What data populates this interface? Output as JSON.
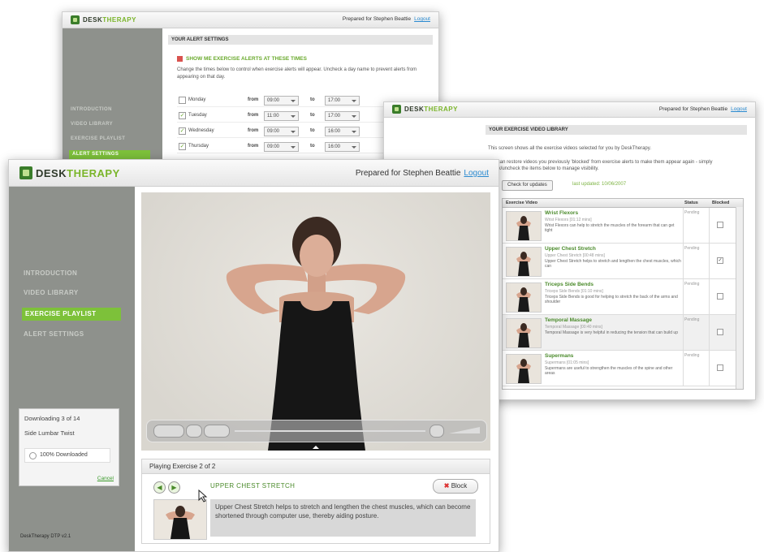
{
  "brand": {
    "part1": "DESK",
    "part2": "THERAPY"
  },
  "colors": {
    "accent_green": "#7dc13a",
    "sidebar_grey": "#8e918c",
    "link_blue": "#2a8ad0"
  },
  "user": {
    "prepared_for": "Prepared for Stephen Beattie",
    "logout": "Logout"
  },
  "alerts_window": {
    "section_title": "YOUR ALERT SETTINGS",
    "heading": "SHOW ME EXERCISE ALERTS AT THESE TIMES",
    "instructions": "Change the times below to control when exercise alerts will appear. Uncheck a day name to prevent alerts from appearing on that day.",
    "nav": [
      "INTRODUCTION",
      "VIDEO LIBRARY",
      "EXERCISE PLAYLIST",
      "ALERT SETTINGS"
    ],
    "from_label": "from",
    "to_label": "to",
    "days": [
      {
        "day": "Monday",
        "checked": false,
        "from": "09:00",
        "to": "17:00"
      },
      {
        "day": "Tuesday",
        "checked": true,
        "from": "11:00",
        "to": "17:00"
      },
      {
        "day": "Wednesday",
        "checked": true,
        "from": "09:00",
        "to": "16:00"
      },
      {
        "day": "Thursday",
        "checked": true,
        "from": "09:00",
        "to": "16:00"
      }
    ]
  },
  "library_window": {
    "section_title": "YOUR EXERCISE VIDEO LIBRARY",
    "intro": "This screen shows all the exercise videos selected for you by DeskTherapy.",
    "intro2": "You can restore videos you previously 'blocked' from exercise alerts to make them appear again - simply check/uncheck the items below to manage visibility.",
    "check_button": "Check for updates",
    "last_updated": "last updated: 10/06/2007",
    "columns": [
      "Exercise Video",
      "Status",
      "Blocked"
    ],
    "rows": [
      {
        "title": "Wrist Flexors",
        "meta": "Wrist Flexors [01:12 mins]",
        "desc": "Wrist Flexors can help to stretch the muscles of the forearm that can get tight",
        "status": "Pending",
        "blocked": false
      },
      {
        "title": "Upper Chest Stretch",
        "meta": "Upper Chest Stretch [00:48 mins]",
        "desc": "Upper Chest Stretch helps to stretch and lengthen the chest muscles, which can",
        "status": "Pending",
        "blocked": true
      },
      {
        "title": "Triceps Side Bends",
        "meta": "Triceps Side Bends [01:10 mins]",
        "desc": "Triceps Side Bends is good for helping to stretch the back of the arms and shoulder",
        "status": "Pending",
        "blocked": false
      },
      {
        "title": "Temporal Massage",
        "meta": "Temporal Massage [00:40 mins]",
        "desc": "Temporal Massage is very helpful in reducing the tension that can build up",
        "status": "Pending",
        "blocked": false
      },
      {
        "title": "Supermans",
        "meta": "Supermans [01:05 mins]",
        "desc": "Supermans are useful to strengthen the muscles of the spine and other areas",
        "status": "Pending",
        "blocked": false
      }
    ]
  },
  "main_window": {
    "nav": [
      "INTRODUCTION",
      "VIDEO LIBRARY",
      "EXERCISE PLAYLIST",
      "ALERT SETTINGS"
    ],
    "active_nav": "EXERCISE PLAYLIST",
    "download": {
      "title": "Downloading 3 of 14",
      "item": "Side Lumbar Twist",
      "status": "100% Downloaded",
      "cancel": "Cancel"
    },
    "version": "DeskTherapy DTP v2.1",
    "playing_label": "Playing Exercise 2 of 2",
    "exercise_title": "UPPER CHEST STRETCH",
    "block_button": "Block",
    "description": "Upper Chest Stretch helps to stretch and lengthen the chest muscles, which can become shortened through computer use, thereby aiding posture."
  }
}
